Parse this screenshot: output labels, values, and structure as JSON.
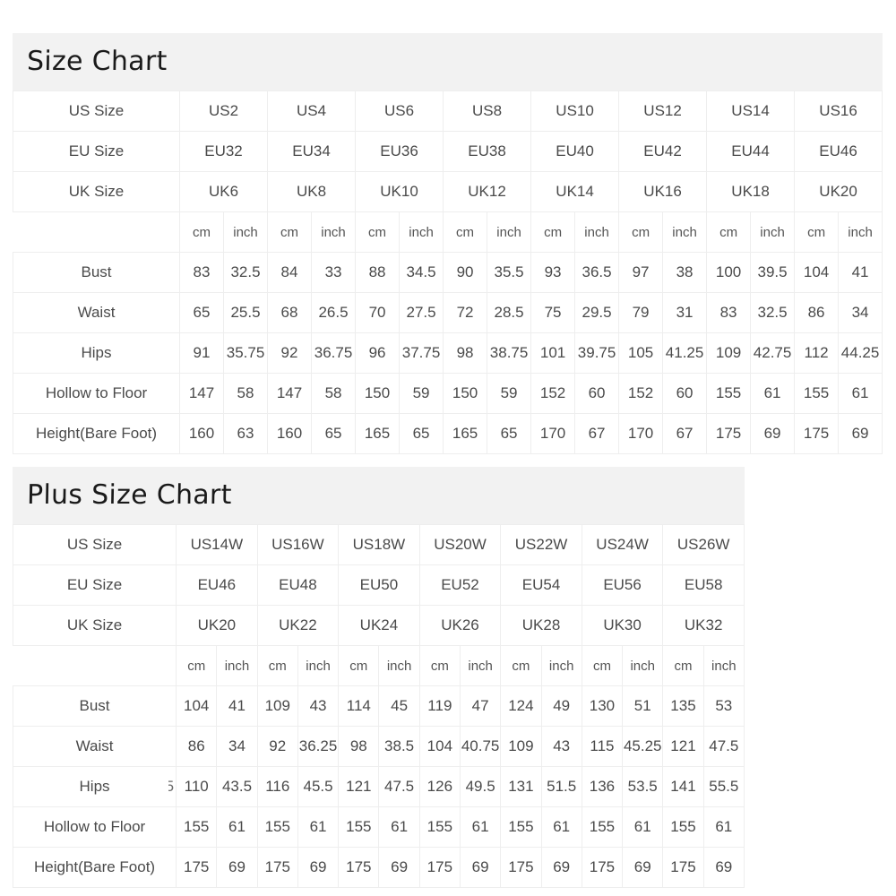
{
  "size_chart": {
    "title": "Size Chart",
    "row_labels": [
      "US Size",
      "EU Size",
      "UK Size",
      "",
      "Bust",
      "Waist",
      "Hips",
      "Hollow to Floor",
      "Height(Bare Foot)"
    ],
    "us_sizes": [
      "US2",
      "US4",
      "US6",
      "US8",
      "US10",
      "US12",
      "US14",
      "US16"
    ],
    "eu_sizes": [
      "EU32",
      "EU34",
      "EU36",
      "EU38",
      "EU40",
      "EU42",
      "EU44",
      "EU46"
    ],
    "uk_sizes": [
      "UK6",
      "UK8",
      "UK10",
      "UK12",
      "UK14",
      "UK16",
      "UK18",
      "UK20"
    ],
    "unit_labels": [
      "cm",
      "inch",
      "cm",
      "inch",
      "cm",
      "inch",
      "cm",
      "inch",
      "cm",
      "inch",
      "cm",
      "inch",
      "cm",
      "inch",
      "cm",
      "inch"
    ],
    "measurements": [
      {
        "label": "Bust",
        "values": [
          "83",
          "32.5",
          "84",
          "33",
          "88",
          "34.5",
          "90",
          "35.5",
          "93",
          "36.5",
          "97",
          "38",
          "100",
          "39.5",
          "104",
          "41"
        ]
      },
      {
        "label": "Waist",
        "values": [
          "65",
          "25.5",
          "68",
          "26.5",
          "70",
          "27.5",
          "72",
          "28.5",
          "75",
          "29.5",
          "79",
          "31",
          "83",
          "32.5",
          "86",
          "34"
        ]
      },
      {
        "label": "Hips",
        "values": [
          "91",
          "35.75",
          "92",
          "36.75",
          "96",
          "37.75",
          "98",
          "38.75",
          "101",
          "39.75",
          "105",
          "41.25",
          "109",
          "42.75",
          "112",
          "44.25"
        ]
      },
      {
        "label": "Hollow to Floor",
        "values": [
          "147",
          "58",
          "147",
          "58",
          "150",
          "59",
          "150",
          "59",
          "152",
          "60",
          "152",
          "60",
          "155",
          "61",
          "155",
          "61"
        ]
      },
      {
        "label": "Height(Bare Foot)",
        "values": [
          "160",
          "63",
          "160",
          "65",
          "165",
          "65",
          "165",
          "65",
          "170",
          "67",
          "170",
          "67",
          "175",
          "69",
          "175",
          "69"
        ]
      }
    ]
  },
  "plus_size_chart": {
    "title": "Plus Size Chart",
    "row_labels": [
      "US Size",
      "EU Size",
      "UK Size",
      "",
      "Bust",
      "Waist",
      "Hips",
      "Hollow to Floor",
      "Height(Bare Foot)"
    ],
    "us_sizes": [
      "US14W",
      "US16W",
      "US18W",
      "US20W",
      "US22W",
      "US24W",
      "US26W"
    ],
    "eu_sizes": [
      "EU46",
      "EU48",
      "EU50",
      "EU52",
      "EU54",
      "EU56",
      "EU58"
    ],
    "uk_sizes": [
      "UK20",
      "UK22",
      "UK24",
      "UK26",
      "UK28",
      "UK30",
      "UK32"
    ],
    "unit_labels": [
      "cm",
      "inch",
      "cm",
      "inch",
      "cm",
      "inch",
      "cm",
      "inch",
      "cm",
      "inch",
      "cm",
      "inch",
      "cm",
      "inch"
    ],
    "hips_label_artifact": "5",
    "measurements": [
      {
        "label": "Bust",
        "values": [
          "104",
          "41",
          "109",
          "43",
          "114",
          "45",
          "119",
          "47",
          "124",
          "49",
          "130",
          "51",
          "135",
          "53"
        ]
      },
      {
        "label": "Waist",
        "values": [
          "86",
          "34",
          "92",
          "36.25",
          "98",
          "38.5",
          "104",
          "40.75",
          "109",
          "43",
          "115",
          "45.25",
          "121",
          "47.5"
        ]
      },
      {
        "label": "Hips",
        "values": [
          "110",
          "43.5",
          "116",
          "45.5",
          "121",
          "47.5",
          "126",
          "49.5",
          "131",
          "51.5",
          "136",
          "53.5",
          "141",
          "55.5"
        ]
      },
      {
        "label": "Hollow to Floor",
        "values": [
          "155",
          "61",
          "155",
          "61",
          "155",
          "61",
          "155",
          "61",
          "155",
          "61",
          "155",
          "61",
          "155",
          "61"
        ]
      },
      {
        "label": "Height(Bare Foot)",
        "values": [
          "175",
          "69",
          "175",
          "69",
          "175",
          "69",
          "175",
          "69",
          "175",
          "69",
          "175",
          "69",
          "175",
          "69"
        ]
      }
    ]
  },
  "colors": {
    "title_bar_background": "#f2f2f2",
    "title_text": "#1a1a1a",
    "cell_text": "#4a4a4a",
    "border": "#eeeeee",
    "page_background": "#ffffff"
  }
}
